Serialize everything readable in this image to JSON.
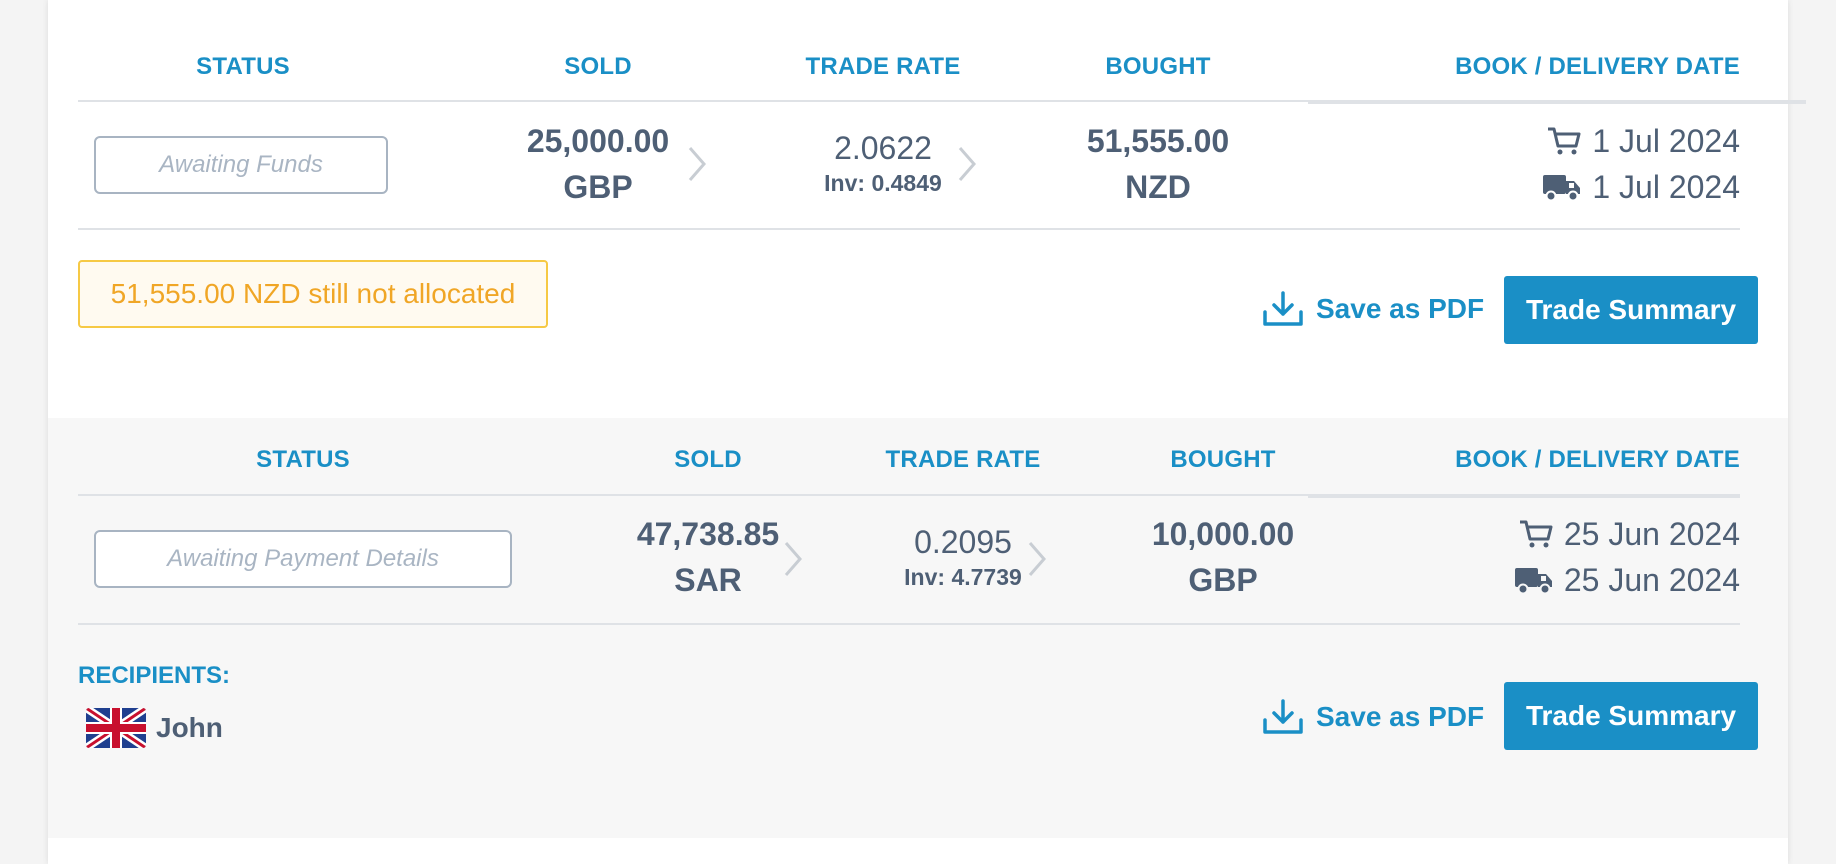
{
  "trades": [
    {
      "headers": {
        "status": "STATUS",
        "sold": "SOLD",
        "trade_rate": "TRADE RATE",
        "bought": "BOUGHT",
        "date": "BOOK / DELIVERY DATE"
      },
      "status": "Awaiting Funds",
      "sold_amount": "25,000.00",
      "sold_currency": "GBP",
      "rate": "2.0622",
      "inverse": "Inv: 0.4849",
      "bought_amount": "51,555.00",
      "bought_currency": "NZD",
      "book_date": "1 Jul 2024",
      "delivery_date": "1 Jul 2024",
      "warning": "51,555.00 NZD still not allocated",
      "save_pdf": "Save as PDF",
      "summary_button": "Trade Summary"
    },
    {
      "headers": {
        "status": "STATUS",
        "sold": "SOLD",
        "trade_rate": "TRADE RATE",
        "bought": "BOUGHT",
        "date": "BOOK / DELIVERY DATE"
      },
      "status": "Awaiting Payment Details",
      "sold_amount": "47,738.85",
      "sold_currency": "SAR",
      "rate": "0.2095",
      "inverse": "Inv: 4.7739",
      "bought_amount": "10,000.00",
      "bought_currency": "GBP",
      "book_date": "25 Jun 2024",
      "delivery_date": "25 Jun 2024",
      "recipients_label": "RECIPIENTS:",
      "recipient_name": "John",
      "recipient_flag": "uk-flag-icon",
      "save_pdf": "Save as PDF",
      "summary_button": "Trade Summary"
    }
  ],
  "colors": {
    "accent": "#1a8fc6",
    "text": "#4e5f75",
    "warning_border": "#f6c945",
    "warning_text": "#f0a626"
  }
}
